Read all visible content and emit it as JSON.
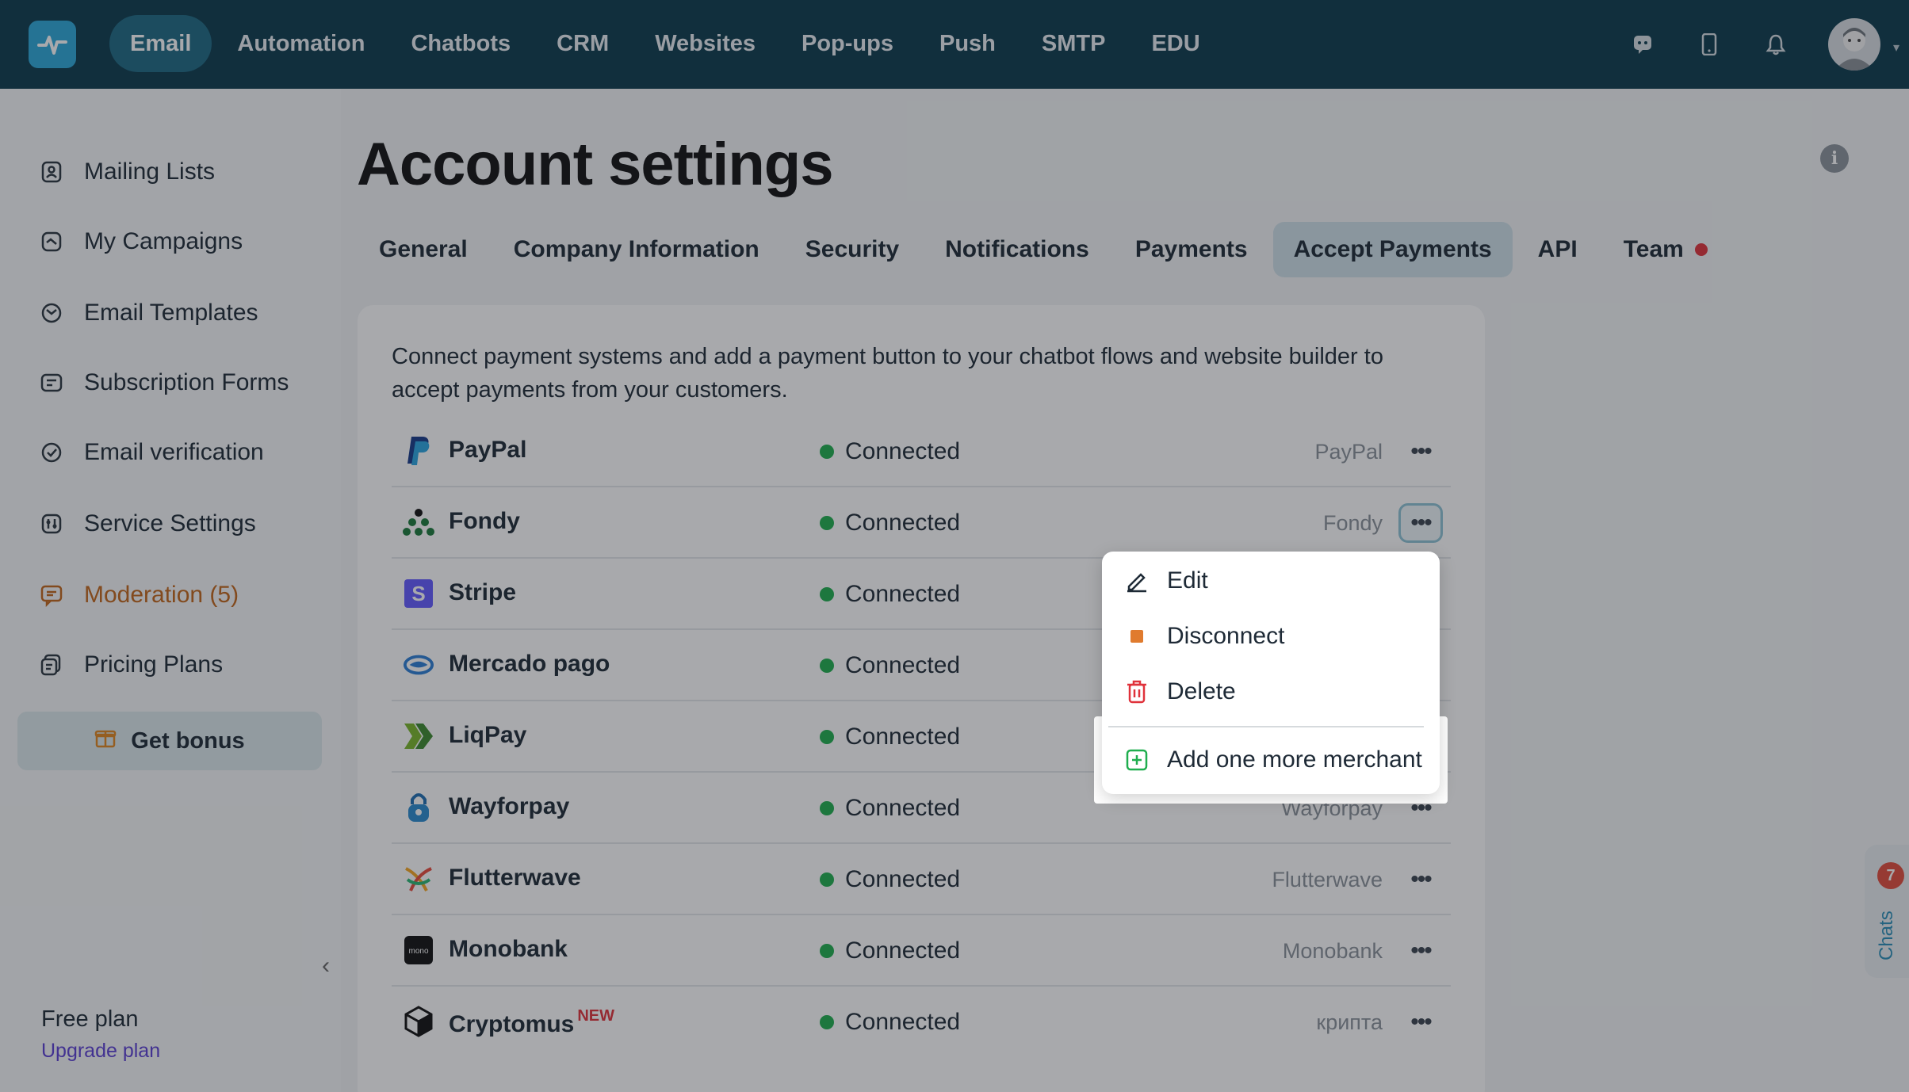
{
  "nav": {
    "items": [
      {
        "label": "Email",
        "active": true
      },
      {
        "label": "Automation"
      },
      {
        "label": "Chatbots"
      },
      {
        "label": "CRM"
      },
      {
        "label": "Websites"
      },
      {
        "label": "Pop-ups"
      },
      {
        "label": "Push"
      },
      {
        "label": "SMTP"
      },
      {
        "label": "EDU"
      }
    ],
    "icons": [
      "chat-bubble-icon",
      "mobile-phone-icon",
      "bell-icon"
    ],
    "avatar": "user-avatar"
  },
  "sidebar": {
    "items": [
      {
        "label": "Mailing Lists",
        "icon": "contacts-icon"
      },
      {
        "label": "My Campaigns",
        "icon": "campaign-icon"
      },
      {
        "label": "Email Templates",
        "icon": "template-icon"
      },
      {
        "label": "Subscription Forms",
        "icon": "form-icon"
      },
      {
        "label": "Email verification",
        "icon": "verify-icon"
      },
      {
        "label": "Service Settings",
        "icon": "settings-icon"
      },
      {
        "label": "Moderation (5)",
        "icon": "moderation-icon"
      },
      {
        "label": "Pricing Plans",
        "icon": "pricing-icon"
      }
    ],
    "bonus_label": "Get bonus",
    "collapse_icon": "chevron-left-icon",
    "plan_label": "Free plan",
    "upgrade_label": "Upgrade plan"
  },
  "page": {
    "title": "Account settings",
    "tabs": [
      {
        "label": "General"
      },
      {
        "label": "Company Information"
      },
      {
        "label": "Security"
      },
      {
        "label": "Notifications"
      },
      {
        "label": "Payments"
      },
      {
        "label": "Accept Payments",
        "active": true
      },
      {
        "label": "API"
      },
      {
        "label": "Team",
        "dot": true
      }
    ]
  },
  "card": {
    "intro": "Connect payment systems and add a payment button to your chatbot flows and website builder to accept payments from your customers.",
    "rows": [
      {
        "name": "PayPal",
        "status": "Connected",
        "merchant": "PayPal",
        "icon": "paypal-icon"
      },
      {
        "name": "Fondy",
        "status": "Connected",
        "merchant": "Fondy",
        "icon": "fondy-icon"
      },
      {
        "name": "Stripe",
        "status": "Connected",
        "merchant": "",
        "icon": "stripe-icon"
      },
      {
        "name": "Mercado pago",
        "status": "Connected",
        "merchant": "",
        "icon": "mercadopago-icon"
      },
      {
        "name": "LiqPay",
        "status": "Connected",
        "merchant": "",
        "icon": "liqpay-icon"
      },
      {
        "name": "Wayforpay",
        "status": "Connected",
        "merchant": "Wayforpay",
        "icon": "wayforpay-icon"
      },
      {
        "name": "Flutterwave",
        "status": "Connected",
        "merchant": "Flutterwave",
        "icon": "flutterwave-icon"
      },
      {
        "name": "Monobank",
        "status": "Connected",
        "merchant": "Monobank",
        "icon": "monobank-icon"
      },
      {
        "name": "Cryptomus",
        "badge": "NEW",
        "status": "Connected",
        "merchant": "крипта",
        "icon": "cryptomus-icon"
      }
    ],
    "more_label": "•••"
  },
  "menu": {
    "edit": "Edit",
    "disconnect": "Disconnect",
    "delete": "Delete",
    "add": "Add one more merchant"
  },
  "chats": {
    "label": "Chats",
    "count": "7"
  },
  "colors": {
    "nav_bg": "#0c3a4d",
    "accent": "#2da8d9",
    "connected": "#1fae4e",
    "moderation": "#c2661a",
    "new_badge": "#e0323b"
  }
}
